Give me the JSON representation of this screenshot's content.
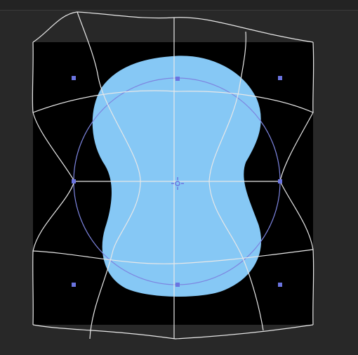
{
  "colors": {
    "workspace": "#282828",
    "artboard": "#000000",
    "shape_fill": "#86c8f5",
    "warp_lines": "#e8e8e8",
    "guide": "#7d85e0",
    "handle": "#6b74e0"
  },
  "tool": {
    "mode": "warp-transform",
    "icons": [
      "center-pivot-icon"
    ]
  }
}
